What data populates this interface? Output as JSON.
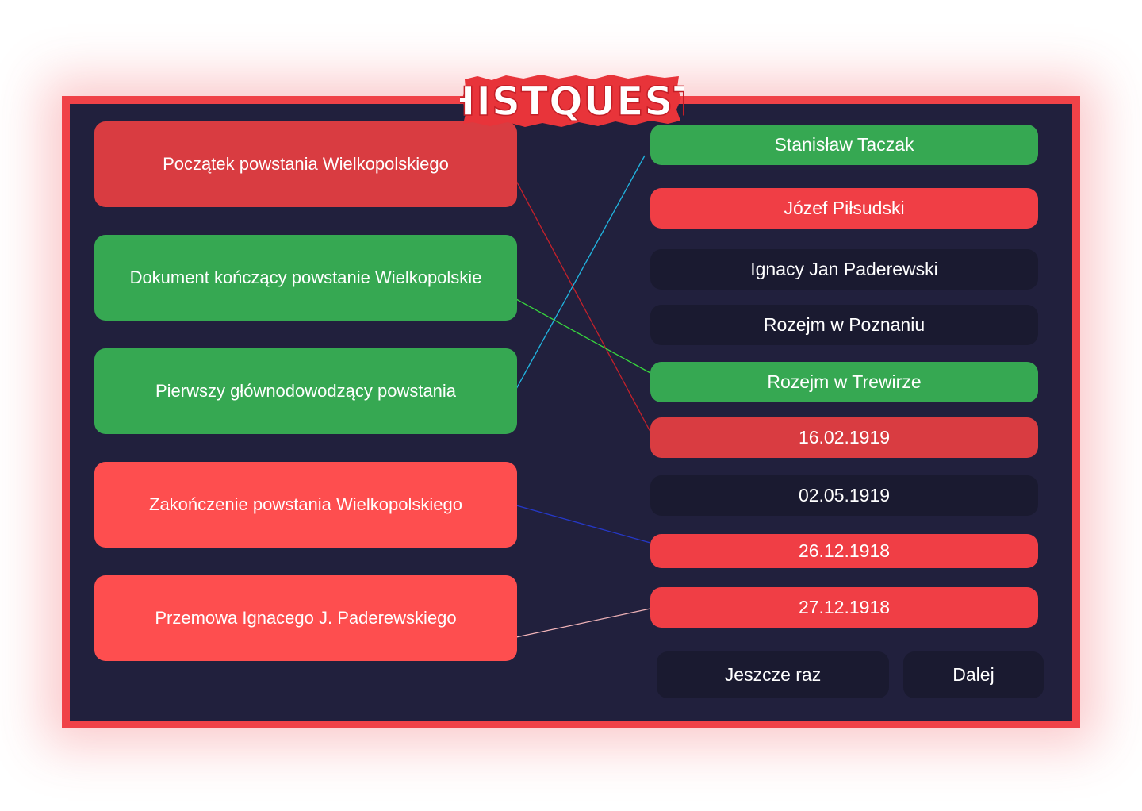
{
  "logo": {
    "text": "HISTQUEST"
  },
  "left_items": [
    {
      "label": "Początek powstania Wielkopolskiego",
      "state": "selected-wrong"
    },
    {
      "label": "Dokument kończący powstanie Wielkopolskie",
      "state": "correct"
    },
    {
      "label": "Pierwszy głównodowodzący powstania",
      "state": "correct"
    },
    {
      "label": "Zakończenie powstania Wielkopolskiego",
      "state": "wrong"
    },
    {
      "label": "Przemowa Ignacego J. Paderewskiego",
      "state": "wrong"
    }
  ],
  "right_items": [
    {
      "label": "Stanisław Taczak",
      "state": "correct"
    },
    {
      "label": "Józef Piłsudski",
      "state": "wrong"
    },
    {
      "label": "Ignacy Jan Paderewski",
      "state": "unmatched"
    },
    {
      "label": "Rozejm w Poznaniu",
      "state": "unmatched"
    },
    {
      "label": "Rozejm w Trewirze",
      "state": "correct"
    },
    {
      "label": "16.02.1919",
      "state": "selected-wrong"
    },
    {
      "label": "02.05.1919",
      "state": "unmatched"
    },
    {
      "label": "26.12.1918",
      "state": "wrong"
    },
    {
      "label": "27.12.1918",
      "state": "wrong"
    }
  ],
  "connections": [
    {
      "from": "Początek powstania Wielkopolskiego",
      "to": "16.02.1919",
      "color": "#c4212b"
    },
    {
      "from": "Dokument kończący powstanie Wielkopolskie",
      "to": "Rozejm w Trewirze",
      "color": "#37d63d"
    },
    {
      "from": "Pierwszy głównodowodzący powstania",
      "to": "Stanisław Taczak",
      "color": "#21b4e0"
    },
    {
      "from": "Zakończenie powstania Wielkopolskiego",
      "to": "26.12.1918",
      "color": "#2538c9"
    },
    {
      "from": "Przemowa Ignacego J. Paderewskiego",
      "to": "27.12.1918",
      "color": "#f0b3b8"
    }
  ],
  "buttons": {
    "retry": "Jeszcze raz",
    "next": "Dalej"
  },
  "colors": {
    "frame": "#f04248",
    "board": "#21203d",
    "correct": "#36a852",
    "wrong": "#fe4e4f",
    "neutral": "#1a1a30"
  }
}
